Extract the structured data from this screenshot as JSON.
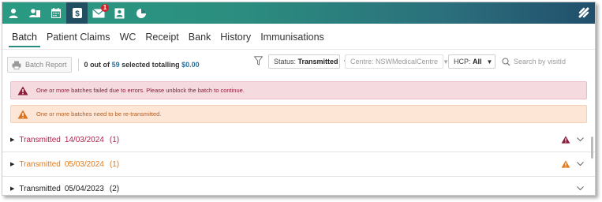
{
  "topbar": {
    "icons": [
      {
        "name": "person-icon",
        "active": false
      },
      {
        "name": "patients-card-icon",
        "active": false
      },
      {
        "name": "calendar-icon",
        "active": false
      },
      {
        "name": "dollar-icon",
        "active": true
      },
      {
        "name": "mail-icon",
        "active": false,
        "badge": "1"
      },
      {
        "name": "contact-card-icon",
        "active": false
      },
      {
        "name": "pie-chart-icon",
        "active": false
      }
    ],
    "logo": "brand-logo-icon"
  },
  "tabs": [
    {
      "label": "Batch",
      "active": true
    },
    {
      "label": "Patient Claims"
    },
    {
      "label": "WC"
    },
    {
      "label": "Receipt"
    },
    {
      "label": "Bank"
    },
    {
      "label": "History"
    },
    {
      "label": "Immunisations"
    }
  ],
  "toolbar": {
    "batch_report_label": "Batch Report",
    "summary": {
      "selected": "0",
      "text1": "out of",
      "total": "59",
      "text2": "selected totalling",
      "amount": "$0.00"
    },
    "status_filter": {
      "label": "Status:",
      "value": "Transmitted"
    },
    "centre_filter": {
      "label": "Centre:",
      "value": "NSWMedicalCentre"
    },
    "hcp_filter": {
      "label": "HCP:",
      "value": "All"
    },
    "search_placeholder": "Search by visitId"
  },
  "alerts": [
    {
      "type": "error",
      "text": "One or more batches failed due to errors. Please unblock the batch to continue."
    },
    {
      "type": "warn",
      "text": "One or more batches need to be re-transmitted."
    }
  ],
  "batches": [
    {
      "status": "Transmitted",
      "date": "14/03/2024",
      "count": "(1)",
      "state": "error"
    },
    {
      "status": "Transmitted",
      "date": "05/03/2024",
      "count": "(1)",
      "state": "warn"
    },
    {
      "status": "Transmitted",
      "date": "05/04/2023",
      "count": "(2)",
      "state": "normal"
    }
  ],
  "colors": {
    "accent": "#2b8d7f",
    "error": "#b21f4a",
    "warning": "#e07b1f",
    "link_number": "#2a6f9b"
  }
}
